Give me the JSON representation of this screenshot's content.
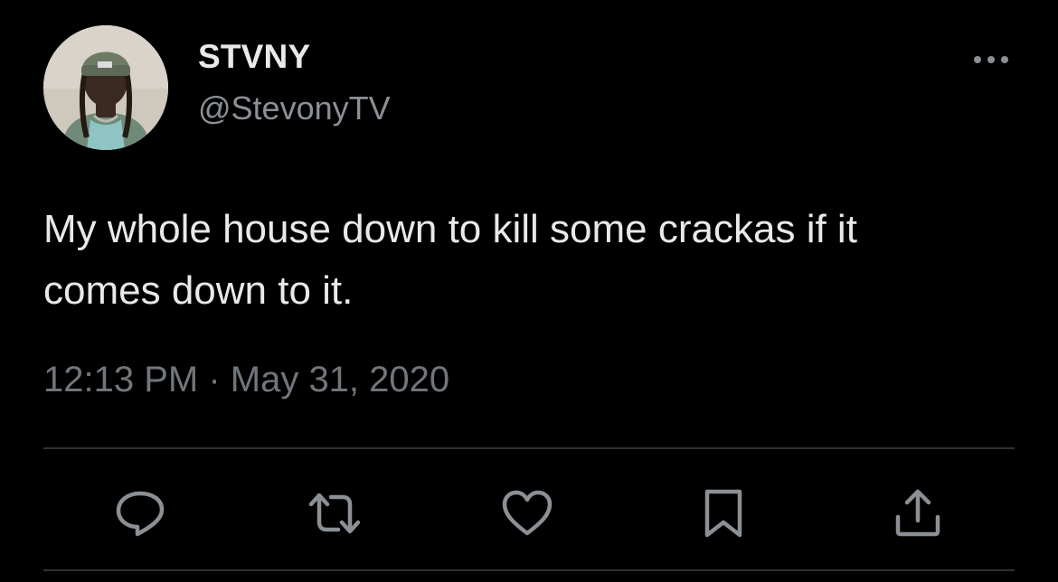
{
  "author": {
    "display_name": "STVNY",
    "handle": "@StevonyTV",
    "avatar_icon": "profile-photo"
  },
  "tweet": {
    "text": "My whole house down to kill some crackas if it\ncomes down to it.",
    "timestamp": "12:13 PM · May 31, 2020"
  },
  "actions": [
    {
      "name": "reply",
      "icon": "speech-bubble-icon"
    },
    {
      "name": "retweet",
      "icon": "retweet-arrows-icon"
    },
    {
      "name": "like",
      "icon": "heart-icon"
    },
    {
      "name": "bookmark",
      "icon": "bookmark-icon"
    },
    {
      "name": "share",
      "icon": "share-upload-icon"
    }
  ],
  "colors": {
    "background": "#000000",
    "primary_text": "#e7e9ea",
    "secondary_text": "#71767b",
    "divider": "#2f3336",
    "icon": "#8b9095"
  }
}
